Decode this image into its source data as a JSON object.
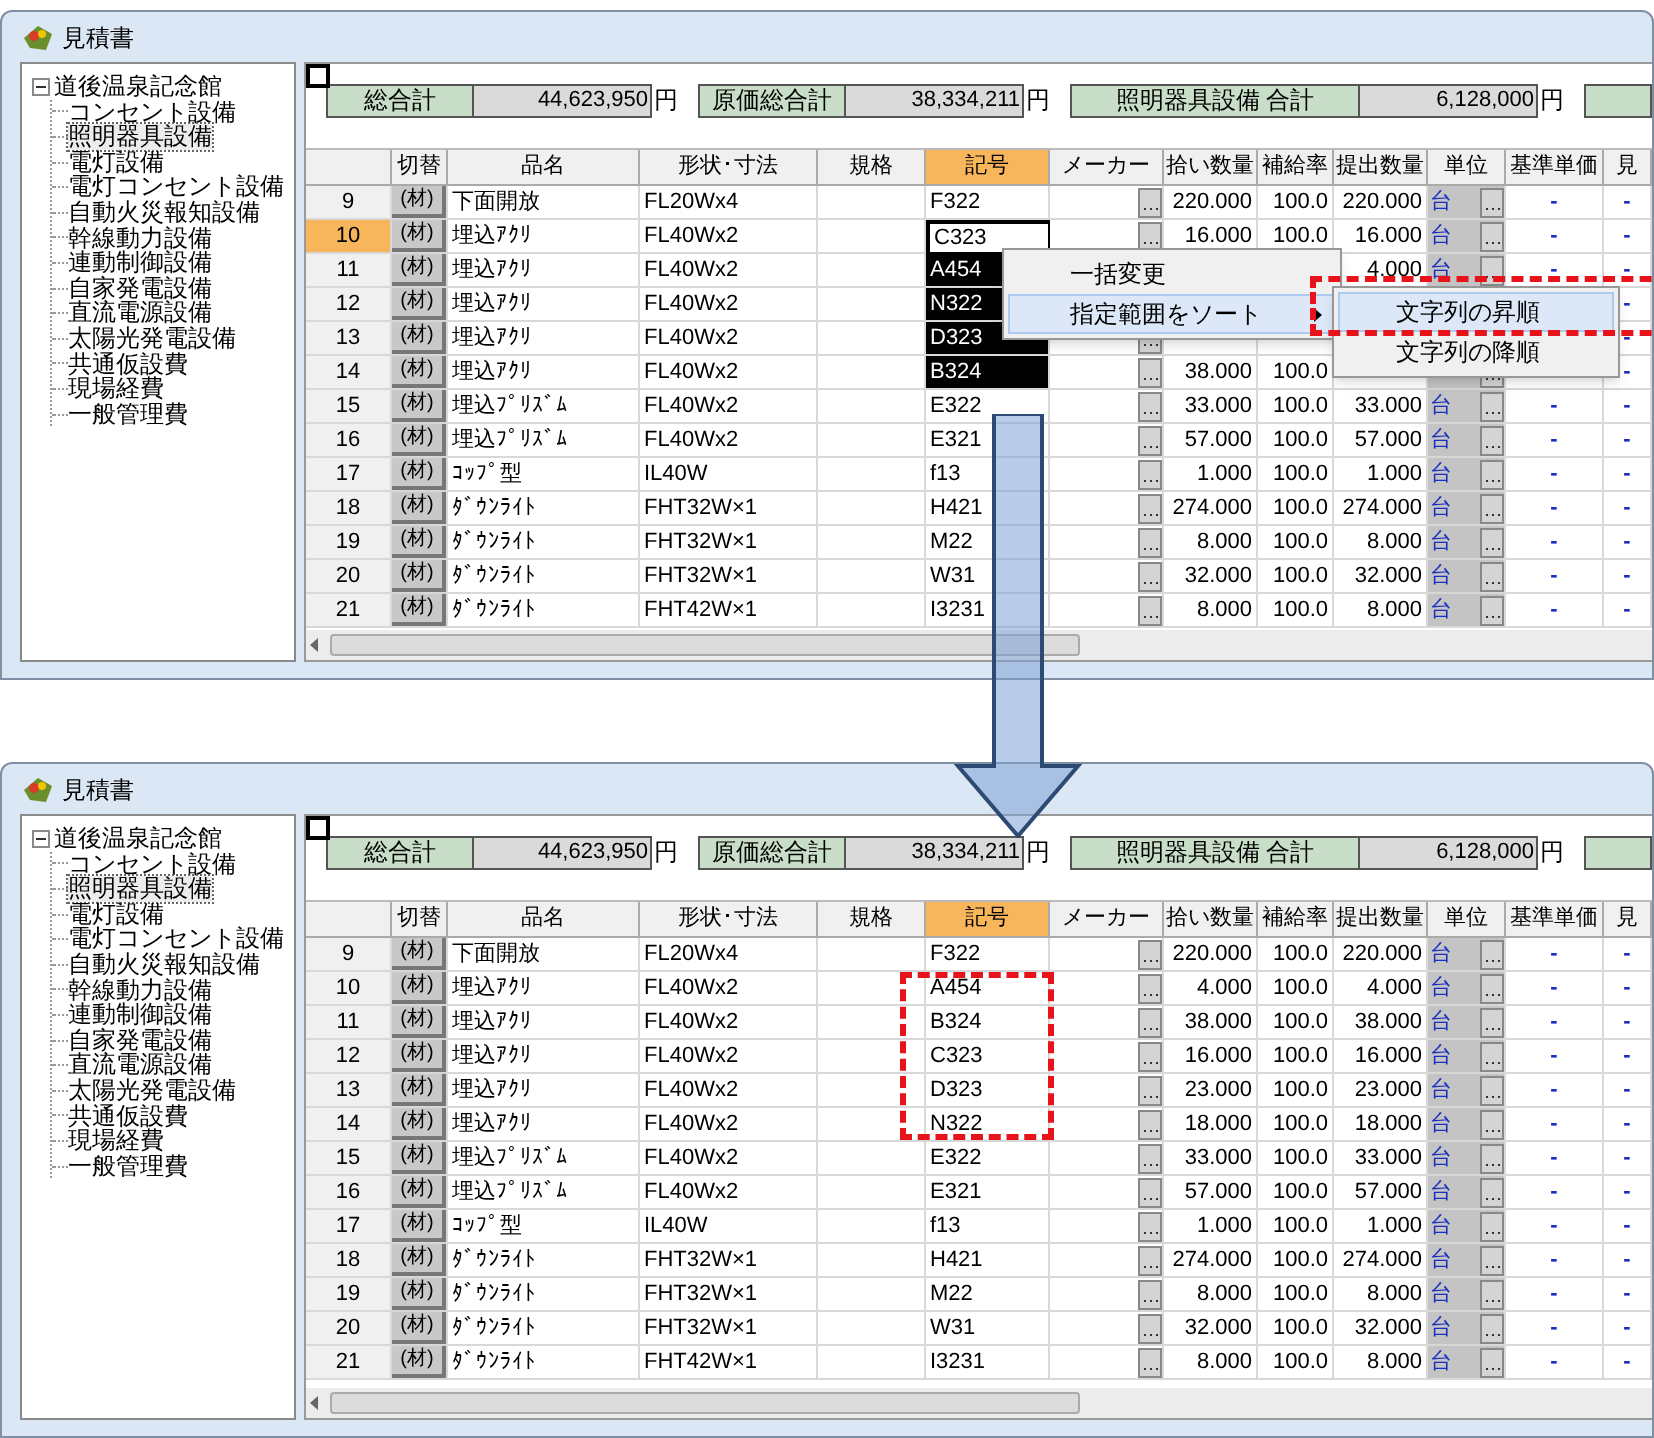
{
  "windows": [
    {
      "title": "見積書",
      "checkbox": {
        "checked": false
      },
      "tree": {
        "label": "道後温泉記念館",
        "expanded": true,
        "children": [
          {
            "label": "コンセント設備",
            "selected": false
          },
          {
            "label": "照明器具設備",
            "selected": true
          },
          {
            "label": "電灯設備",
            "selected": false
          },
          {
            "label": "電灯コンセント設備",
            "selected": false
          },
          {
            "label": "自動火災報知設備",
            "selected": false
          },
          {
            "label": "幹線動力設備",
            "selected": false
          },
          {
            "label": "連動制御設備",
            "selected": false
          },
          {
            "label": "自家発電設備",
            "selected": false
          },
          {
            "label": "直流電源設備",
            "selected": false
          },
          {
            "label": "太陽光発電設備",
            "selected": false
          },
          {
            "label": "共通仮設費",
            "selected": false
          },
          {
            "label": "現場経費",
            "selected": false
          },
          {
            "label": "一般管理費",
            "selected": false
          }
        ]
      },
      "totals": [
        {
          "label": "総合計",
          "value": "44,623,950",
          "unit": "円"
        },
        {
          "label": "原価総合計",
          "value": "38,334,211",
          "unit": "円"
        },
        {
          "label": "照明器具設備 合計",
          "value": "6,128,000",
          "unit": "円"
        }
      ],
      "columns": [
        {
          "kind": "rowhead",
          "selected": false
        },
        {
          "kind": "switch",
          "label": "切替",
          "selected": false
        },
        {
          "kind": "text",
          "label": "品名",
          "selected": false
        },
        {
          "kind": "text",
          "label": "形状･寸法",
          "selected": false
        },
        {
          "kind": "text",
          "label": "規格",
          "selected": false
        },
        {
          "kind": "code",
          "label": "記号",
          "selected": true
        },
        {
          "kind": "maker",
          "label": "メーカー",
          "selected": false
        },
        {
          "kind": "num",
          "label": "拾い数量",
          "selected": false
        },
        {
          "kind": "num",
          "label": "補給率",
          "selected": false
        },
        {
          "kind": "num",
          "label": "提出数量",
          "selected": false
        },
        {
          "kind": "unit",
          "label": "単位",
          "selected": false
        },
        {
          "kind": "dash",
          "label": "基準単価",
          "selected": false
        },
        {
          "kind": "dash",
          "label": "見",
          "selected": false
        }
      ],
      "rows": [
        {
          "selected": false,
          "code_highlighted": false,
          "cells": [
            "9",
            "(材)",
            "下面開放",
            "FL20Wx4",
            null,
            "F322",
            null,
            "220.000",
            "100.0",
            "220.000",
            "台",
            "-",
            "-"
          ]
        },
        {
          "selected": true,
          "code_highlighted": false,
          "cells": [
            "10",
            "(材)",
            "埋込ｱｸﾘ",
            "FL40Wx2",
            null,
            "C323",
            null,
            "16.000",
            "100.0",
            "16.000",
            "台",
            "-",
            "-"
          ]
        },
        {
          "selected": false,
          "code_highlighted": true,
          "cells": [
            "11",
            "(材)",
            "埋込ｱｸﾘ",
            "FL40Wx2",
            null,
            "A454",
            null,
            null,
            null,
            "4.000",
            "台",
            "-",
            "-"
          ]
        },
        {
          "selected": false,
          "code_highlighted": true,
          "cells": [
            "12",
            "(材)",
            "埋込ｱｸﾘ",
            "FL40Wx2",
            null,
            "N322",
            null,
            null,
            null,
            null,
            null,
            null,
            "-"
          ]
        },
        {
          "selected": false,
          "code_highlighted": true,
          "cells": [
            "13",
            "(材)",
            "埋込ｱｸﾘ",
            "FL40Wx2",
            null,
            "D323",
            null,
            null,
            null,
            null,
            null,
            null,
            "-"
          ]
        },
        {
          "selected": false,
          "code_highlighted": true,
          "cells": [
            "14",
            "(材)",
            "埋込ｱｸﾘ",
            "FL40Wx2",
            null,
            "B324",
            null,
            "38.000",
            "100.0",
            null,
            null,
            null,
            "-"
          ]
        },
        {
          "selected": false,
          "code_highlighted": false,
          "cells": [
            "15",
            "(材)",
            "埋込ﾌﾟﾘｽﾞﾑ",
            "FL40Wx2",
            null,
            "E322",
            null,
            "33.000",
            "100.0",
            "33.000",
            "台",
            "-",
            "-"
          ]
        },
        {
          "selected": false,
          "code_highlighted": false,
          "cells": [
            "16",
            "(材)",
            "埋込ﾌﾟﾘｽﾞﾑ",
            "FL40Wx2",
            null,
            "E321",
            null,
            "57.000",
            "100.0",
            "57.000",
            "台",
            "-",
            "-"
          ]
        },
        {
          "selected": false,
          "code_highlighted": false,
          "cells": [
            "17",
            "(材)",
            "ｺｯﾌﾟ型",
            "IL40W",
            null,
            "f13",
            null,
            "1.000",
            "100.0",
            "1.000",
            "台",
            "-",
            "-"
          ]
        },
        {
          "selected": false,
          "code_highlighted": false,
          "cells": [
            "18",
            "(材)",
            "ﾀﾞｳﾝﾗｲﾄ",
            "FHT32W×1",
            null,
            "H421",
            null,
            "274.000",
            "100.0",
            "274.000",
            "台",
            "-",
            "-"
          ]
        },
        {
          "selected": false,
          "code_highlighted": false,
          "cells": [
            "19",
            "(材)",
            "ﾀﾞｳﾝﾗｲﾄ",
            "FHT32W×1",
            null,
            "M22",
            null,
            "8.000",
            "100.0",
            "8.000",
            "台",
            "-",
            "-"
          ]
        },
        {
          "selected": false,
          "code_highlighted": false,
          "cells": [
            "20",
            "(材)",
            "ﾀﾞｳﾝﾗｲﾄ",
            "FHT32W×1",
            null,
            "W31",
            null,
            "32.000",
            "100.0",
            "32.000",
            "台",
            "-",
            "-"
          ]
        },
        {
          "selected": false,
          "code_highlighted": false,
          "cells": [
            "21",
            "(材)",
            "ﾀﾞｳﾝﾗｲﾄ",
            "FHT42W×1",
            null,
            "I3231",
            null,
            "8.000",
            "100.0",
            "8.000",
            "台",
            "-",
            "-"
          ]
        }
      ],
      "context_menu": {
        "items": [
          {
            "label": "一括変更",
            "selected": false,
            "has_submenu": false
          },
          {
            "label": "指定範囲をソート",
            "selected": true,
            "has_submenu": true
          }
        ],
        "submenu": [
          {
            "label": "文字列の昇順",
            "selected": true
          },
          {
            "label": "文字列の降順",
            "selected": false
          }
        ]
      }
    },
    {
      "title": "見積書",
      "checkbox": {
        "checked": false
      },
      "tree": {
        "label": "道後温泉記念館",
        "expanded": true,
        "children": [
          {
            "label": "コンセント設備",
            "selected": false
          },
          {
            "label": "照明器具設備",
            "selected": true
          },
          {
            "label": "電灯設備",
            "selected": false
          },
          {
            "label": "電灯コンセント設備",
            "selected": false
          },
          {
            "label": "自動火災報知設備",
            "selected": false
          },
          {
            "label": "幹線動力設備",
            "selected": false
          },
          {
            "label": "連動制御設備",
            "selected": false
          },
          {
            "label": "自家発電設備",
            "selected": false
          },
          {
            "label": "直流電源設備",
            "selected": false
          },
          {
            "label": "太陽光発電設備",
            "selected": false
          },
          {
            "label": "共通仮設費",
            "selected": false
          },
          {
            "label": "現場経費",
            "selected": false
          },
          {
            "label": "一般管理費",
            "selected": false
          }
        ]
      },
      "totals": [
        {
          "label": "総合計",
          "value": "44,623,950",
          "unit": "円"
        },
        {
          "label": "原価総合計",
          "value": "38,334,211",
          "unit": "円"
        },
        {
          "label": "照明器具設備 合計",
          "value": "6,128,000",
          "unit": "円"
        }
      ],
      "columns": [
        {
          "kind": "rowhead",
          "selected": false
        },
        {
          "kind": "switch",
          "label": "切替",
          "selected": false
        },
        {
          "kind": "text",
          "label": "品名",
          "selected": false
        },
        {
          "kind": "text",
          "label": "形状･寸法",
          "selected": false
        },
        {
          "kind": "text",
          "label": "規格",
          "selected": false
        },
        {
          "kind": "code",
          "label": "記号",
          "selected": true
        },
        {
          "kind": "maker",
          "label": "メーカー",
          "selected": false
        },
        {
          "kind": "num",
          "label": "拾い数量",
          "selected": false
        },
        {
          "kind": "num",
          "label": "補給率",
          "selected": false
        },
        {
          "kind": "num",
          "label": "提出数量",
          "selected": false
        },
        {
          "kind": "unit",
          "label": "単位",
          "selected": false
        },
        {
          "kind": "dash",
          "label": "基準単価",
          "selected": false
        },
        {
          "kind": "dash",
          "label": "見",
          "selected": false
        }
      ],
      "rows": [
        {
          "selected": false,
          "code_highlighted": false,
          "cells": [
            "9",
            "(材)",
            "下面開放",
            "FL20Wx4",
            null,
            "F322",
            null,
            "220.000",
            "100.0",
            "220.000",
            "台",
            "-",
            "-"
          ]
        },
        {
          "selected": false,
          "code_highlighted": false,
          "cells": [
            "10",
            "(材)",
            "埋込ｱｸﾘ",
            "FL40Wx2",
            null,
            "A454",
            null,
            "4.000",
            "100.0",
            "4.000",
            "台",
            "-",
            "-"
          ]
        },
        {
          "selected": false,
          "code_highlighted": false,
          "cells": [
            "11",
            "(材)",
            "埋込ｱｸﾘ",
            "FL40Wx2",
            null,
            "B324",
            null,
            "38.000",
            "100.0",
            "38.000",
            "台",
            "-",
            "-"
          ]
        },
        {
          "selected": false,
          "code_highlighted": false,
          "cells": [
            "12",
            "(材)",
            "埋込ｱｸﾘ",
            "FL40Wx2",
            null,
            "C323",
            null,
            "16.000",
            "100.0",
            "16.000",
            "台",
            "-",
            "-"
          ]
        },
        {
          "selected": false,
          "code_highlighted": false,
          "cells": [
            "13",
            "(材)",
            "埋込ｱｸﾘ",
            "FL40Wx2",
            null,
            "D323",
            null,
            "23.000",
            "100.0",
            "23.000",
            "台",
            "-",
            "-"
          ]
        },
        {
          "selected": false,
          "code_highlighted": false,
          "cells": [
            "14",
            "(材)",
            "埋込ｱｸﾘ",
            "FL40Wx2",
            null,
            "N322",
            null,
            "18.000",
            "100.0",
            "18.000",
            "台",
            "-",
            "-"
          ]
        },
        {
          "selected": false,
          "code_highlighted": false,
          "cells": [
            "15",
            "(材)",
            "埋込ﾌﾟﾘｽﾞﾑ",
            "FL40Wx2",
            null,
            "E322",
            null,
            "33.000",
            "100.0",
            "33.000",
            "台",
            "-",
            "-"
          ]
        },
        {
          "selected": false,
          "code_highlighted": false,
          "cells": [
            "16",
            "(材)",
            "埋込ﾌﾟﾘｽﾞﾑ",
            "FL40Wx2",
            null,
            "E321",
            null,
            "57.000",
            "100.0",
            "57.000",
            "台",
            "-",
            "-"
          ]
        },
        {
          "selected": false,
          "code_highlighted": false,
          "cells": [
            "17",
            "(材)",
            "ｺｯﾌﾟ型",
            "IL40W",
            null,
            "f13",
            null,
            "1.000",
            "100.0",
            "1.000",
            "台",
            "-",
            "-"
          ]
        },
        {
          "selected": false,
          "code_highlighted": false,
          "cells": [
            "18",
            "(材)",
            "ﾀﾞｳﾝﾗｲﾄ",
            "FHT32W×1",
            null,
            "H421",
            null,
            "274.000",
            "100.0",
            "274.000",
            "台",
            "-",
            "-"
          ]
        },
        {
          "selected": false,
          "code_highlighted": false,
          "cells": [
            "19",
            "(材)",
            "ﾀﾞｳﾝﾗｲﾄ",
            "FHT32W×1",
            null,
            "M22",
            null,
            "8.000",
            "100.0",
            "8.000",
            "台",
            "-",
            "-"
          ]
        },
        {
          "selected": false,
          "code_highlighted": false,
          "cells": [
            "20",
            "(材)",
            "ﾀﾞｳﾝﾗｲﾄ",
            "FHT32W×1",
            null,
            "W31",
            null,
            "32.000",
            "100.0",
            "32.000",
            "台",
            "-",
            "-"
          ]
        },
        {
          "selected": false,
          "code_highlighted": false,
          "cells": [
            "21",
            "(材)",
            "ﾀﾞｳﾝﾗｲﾄ",
            "FHT42W×1",
            null,
            "I3231",
            null,
            "8.000",
            "100.0",
            "8.000",
            "台",
            "-",
            "-"
          ]
        }
      ]
    }
  ]
}
